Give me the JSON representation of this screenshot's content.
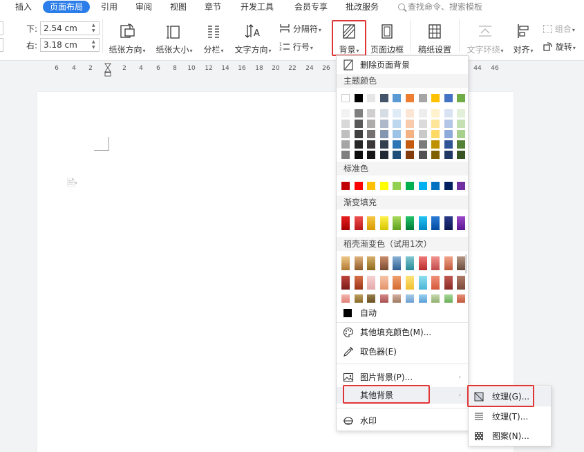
{
  "tabs": [
    {
      "label": "插入",
      "active": false
    },
    {
      "label": "页面布局",
      "active": true
    },
    {
      "label": "引用",
      "active": false
    },
    {
      "label": "审阅",
      "active": false
    },
    {
      "label": "视图",
      "active": false
    },
    {
      "label": "章节",
      "active": false
    },
    {
      "label": "开发工具",
      "active": false
    },
    {
      "label": "会员专享",
      "active": false
    },
    {
      "label": "批改服务",
      "active": false
    }
  ],
  "search_placeholder": "查找命令、搜索模板",
  "margins": {
    "bottom_label": "下:",
    "bottom_value": "2.54 cm",
    "right_label": "右:",
    "right_value": "3.18 cm"
  },
  "ribbon": {
    "orientation": "纸张方向",
    "size": "纸张大小",
    "columns": "分栏",
    "text_direction": "文字方向",
    "breaks": "分隔符",
    "line_numbers": "行号",
    "background": "背景",
    "page_border": "页面边框",
    "manuscript": "稿纸设置",
    "text_wrap": "文字环绕",
    "align": "对齐",
    "group": "组合",
    "rotate": "旋转"
  },
  "ruler_ticks": [
    "6",
    "4",
    "2",
    "2",
    "4",
    "6",
    "8",
    "10",
    "12",
    "14",
    "16",
    "18",
    "20",
    "22",
    "24",
    "26",
    "44",
    "46"
  ],
  "menu": {
    "remove_bg": "删除页面背景",
    "theme_colors_title": "主题颜色",
    "standard_colors_title": "标准色",
    "gradient_title": "渐变填充",
    "docer_gradient_title": "稻壳渐变色（试用1次）",
    "auto": "自动",
    "more_fill": "其他填充颜色(M)...",
    "eyedropper": "取色器(E)",
    "picture_bg": "图片背景(P)...",
    "other_bg": "其他背景",
    "watermark": "水印"
  },
  "theme_top": [
    "#ffffff",
    "#000000",
    "#e7e6e6",
    "#44546a",
    "#5b9bd5",
    "#ed7d31",
    "#a5a5a5",
    "#ffc000",
    "#4472c4",
    "#70ad47"
  ],
  "theme_shades": [
    [
      "#f2f2f2",
      "#7f7f7f",
      "#d0cece",
      "#d6dce4",
      "#deebf6",
      "#fbe5d5",
      "#ededed",
      "#fff2cc",
      "#d9e2f3",
      "#e2efd9"
    ],
    [
      "#d8d8d8",
      "#595959",
      "#aeabab",
      "#adb9ca",
      "#bdd7ee",
      "#f7cbac",
      "#dbdbdb",
      "#fee599",
      "#b4c6e7",
      "#c5e0b3"
    ],
    [
      "#bfbfbf",
      "#3f3f3f",
      "#757070",
      "#8496b0",
      "#9cc3e5",
      "#f4b183",
      "#c9c9c9",
      "#ffd965",
      "#8eaadb",
      "#a8d08d"
    ],
    [
      "#a5a5a5",
      "#262626",
      "#3a3838",
      "#323f4f",
      "#2e75b5",
      "#c55a11",
      "#7b7b7b",
      "#bf9000",
      "#2f5496",
      "#538135"
    ],
    [
      "#7f7f7f",
      "#0c0c0c",
      "#171616",
      "#222a35",
      "#1e4e79",
      "#833c0b",
      "#525252",
      "#7f6000",
      "#1f3864",
      "#375623"
    ]
  ],
  "standard_colors": [
    "#c00000",
    "#ff0000",
    "#ffc000",
    "#ffff00",
    "#92d050",
    "#00b050",
    "#00b0f0",
    "#0070c0",
    "#002060",
    "#7030a0"
  ],
  "gradient_colors": [
    [
      "#e81e1e",
      "#a50000"
    ],
    [
      "#f05050",
      "#b81818"
    ],
    [
      "#f6c845",
      "#d99a00"
    ],
    [
      "#fff24a",
      "#d6c400"
    ],
    [
      "#a8da5c",
      "#5e9e1e"
    ],
    [
      "#22c46a",
      "#007a36"
    ],
    [
      "#22c4f6",
      "#0086c0"
    ],
    [
      "#2b7bd6",
      "#004a9e"
    ],
    [
      "#2a3a8a",
      "#0b1650"
    ],
    [
      "#9a48c8",
      "#5a1690"
    ]
  ],
  "docer_rows": [
    [
      [
        "#f0c787",
        "#b07a32"
      ],
      [
        "#e0b27c",
        "#8e5a2a"
      ],
      [
        "#d7b06a",
        "#8b6a1c"
      ],
      [
        "#c98c6a",
        "#7a4a30"
      ],
      [
        "#8ab2d6",
        "#2e5e90"
      ],
      [
        "#7fc7d2",
        "#2a8a98"
      ],
      [
        "#f07a7a",
        "#b82a2a"
      ],
      [
        "#f2928e",
        "#c04a4a"
      ],
      [
        "#f2a48a",
        "#c0583a"
      ],
      [
        "#b49482",
        "#6a4a3a"
      ]
    ],
    [
      [
        "#c0443c",
        "#7a1a18"
      ],
      [
        "#d9704a",
        "#9a3418"
      ],
      [
        "#f6d2d2",
        "#e4aaa8"
      ],
      [
        "#f6c4a8",
        "#e4946a"
      ],
      [
        "#f0a070",
        "#d46a32"
      ],
      [
        "#fde47a",
        "#f0c030"
      ],
      [
        "#8fe0f0",
        "#4ab4d6"
      ],
      [
        "#f0907a",
        "#d45a3a"
      ],
      [
        "#c05a52",
        "#8a2a24"
      ],
      [
        "#b07a66",
        "#7a4a3a"
      ]
    ],
    [
      [
        "#f4b6ae",
        "#e08078"
      ],
      [
        "#c0a060",
        "#8a6a2a"
      ],
      [
        "#9a8050",
        "#6a5020"
      ],
      [
        "#d48a8a",
        "#a85050"
      ],
      [
        "#d4b0a0",
        "#a07a60"
      ],
      [
        "#a8cce8",
        "#6a9ed0"
      ],
      [
        "#9ad0f0",
        "#5aa0d6"
      ],
      [
        "#c8d8b0",
        "#90b070"
      ],
      [
        "#a8d898",
        "#6aae58"
      ],
      [
        "#e8907a",
        "#c0583e"
      ]
    ]
  ],
  "submenu": {
    "texture": "纹理(G)...",
    "pattern_line": "纹理(T)...",
    "pattern": "图案(N)..."
  }
}
